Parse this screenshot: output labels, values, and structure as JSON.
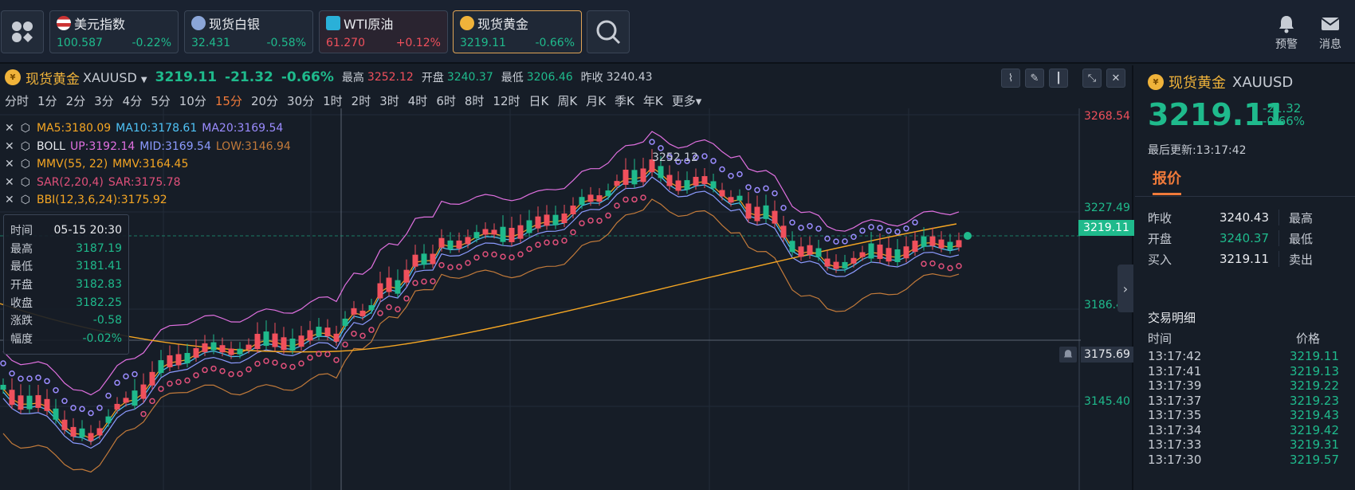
{
  "topbar": {
    "tickers": [
      {
        "name": "美元指数",
        "price": "100.587",
        "change": "-0.22%",
        "dir": "down"
      },
      {
        "name": "现货白银",
        "price": "32.431",
        "change": "-0.58%",
        "dir": "down"
      },
      {
        "name": "WTI原油",
        "price": "61.270",
        "change": "+0.12%",
        "dir": "up"
      },
      {
        "name": "现货黄金",
        "price": "3219.11",
        "change": "-0.66%",
        "dir": "down"
      }
    ],
    "alert_label": "预警",
    "message_label": "消息"
  },
  "chart_header": {
    "title": "现货黄金",
    "symbol": "XAUUSD",
    "price": "3219.11",
    "change": "-21.32",
    "change_pct": "-0.66%",
    "high_label": "最高",
    "high": "3252.12",
    "open_label": "开盘",
    "open": "3240.37",
    "low_label": "最低",
    "low": "3206.46",
    "prev_label": "昨收",
    "prev": "3240.43"
  },
  "periods": [
    "分时",
    "1分",
    "2分",
    "3分",
    "4分",
    "5分",
    "10分",
    "15分",
    "20分",
    "30分",
    "1时",
    "2时",
    "3时",
    "4时",
    "6时",
    "8时",
    "12时",
    "日K",
    "周K",
    "月K",
    "季K",
    "年K",
    "更多"
  ],
  "active_period": "15分",
  "indicators": [
    {
      "parts": [
        {
          "t": "MA5:3180.09",
          "c": "#f5a623"
        },
        {
          "t": "MA10:3178.61",
          "c": "#4fc3f7"
        },
        {
          "t": "MA20:3169.54",
          "c": "#9b8cff"
        }
      ]
    },
    {
      "parts": [
        {
          "t": "BOLL",
          "c": "#e8eaee"
        },
        {
          "t": "UP:3192.14",
          "c": "#e070e0"
        },
        {
          "t": "MID:3169.54",
          "c": "#8c9bff"
        },
        {
          "t": "LOW:3146.94",
          "c": "#c27a3a"
        }
      ]
    },
    {
      "parts": [
        {
          "t": "MMV(55, 22)",
          "c": "#f5a623"
        },
        {
          "t": "MMV:3164.45",
          "c": "#f5a623"
        }
      ]
    },
    {
      "parts": [
        {
          "t": "SAR(2,20,4)",
          "c": "#e0507a"
        },
        {
          "t": "SAR:3175.78",
          "c": "#e0507a"
        }
      ]
    },
    {
      "parts": [
        {
          "t": "BBI(12,3,6,24):3175.92",
          "c": "#f5a623"
        }
      ]
    }
  ],
  "tooltip": {
    "time_label": "时间",
    "time": "05-15 20:30",
    "high_label": "最高",
    "high": "3187.19",
    "low_label": "最低",
    "low": "3181.41",
    "open_label": "开盘",
    "open": "3182.83",
    "close_label": "收盘",
    "close": "3182.25",
    "chg_label": "涨跌",
    "chg": "-0.58",
    "amp_label": "幅度",
    "amp": "-0.02%"
  },
  "price_axis": {
    "ticks": [
      "3268.54",
      "3227.49",
      "3186.45",
      "3145.40"
    ],
    "last_price": "3219.11",
    "cross_price": "3175.69",
    "peak_label": "3252.12"
  },
  "right_panel": {
    "title": "现货黄金",
    "symbol": "XAUUSD",
    "price": "3219.11",
    "change": "-21.32",
    "change_pct": "-0.66%",
    "updated": "最后更新:13:17:42",
    "tab": "报价",
    "quotes": [
      {
        "k": "昨收",
        "v": "3240.43",
        "color": "#e8eaee",
        "k2": "最高"
      },
      {
        "k": "开盘",
        "v": "3240.37",
        "color": "#1fba8c",
        "k2": "最低"
      },
      {
        "k": "买入",
        "v": "3219.11",
        "color": "#e8eaee",
        "k2": "卖出"
      }
    ],
    "trade_title": "交易明细",
    "trade_time_label": "时间",
    "trade_price_label": "价格",
    "trades": [
      {
        "t": "13:17:42",
        "p": "3219.11"
      },
      {
        "t": "13:17:41",
        "p": "3219.13"
      },
      {
        "t": "13:17:39",
        "p": "3219.22"
      },
      {
        "t": "13:17:37",
        "p": "3219.23"
      },
      {
        "t": "13:17:35",
        "p": "3219.43"
      },
      {
        "t": "13:17:34",
        "p": "3219.42"
      },
      {
        "t": "13:17:33",
        "p": "3219.31"
      },
      {
        "t": "13:17:30",
        "p": "3219.57"
      }
    ]
  },
  "colors": {
    "up": "#f0505c",
    "down": "#1fba8c",
    "accent": "#f07a3a",
    "gold": "#f0b33a"
  }
}
